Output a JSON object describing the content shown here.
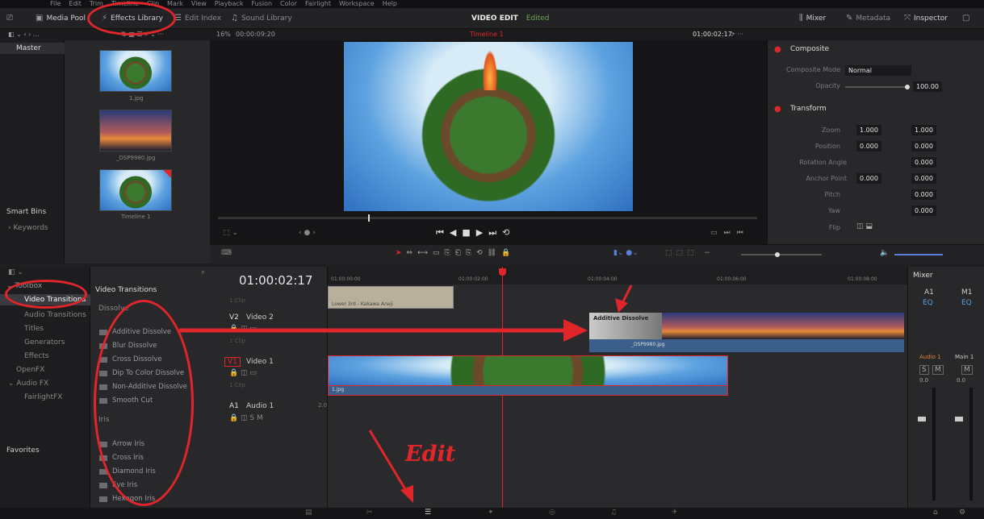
{
  "menubar": [
    "File",
    "Edit",
    "Trim",
    "Timeline",
    "Clip",
    "Mark",
    "View",
    "Playback",
    "Fusion",
    "Color",
    "Fairlight",
    "Workspace",
    "Help"
  ],
  "toolbar": {
    "media_pool": "Media Pool",
    "effects_library": "Effects Library",
    "edit_index": "Edit Index",
    "sound_library": "Sound Library",
    "project_title": "VIDEO EDIT",
    "project_status": "Edited",
    "mixer": "Mixer",
    "metadata": "Metadata",
    "inspector": "Inspector"
  },
  "viewer": {
    "zoom": "16%",
    "source_tc": "00:00:09:20",
    "timeline_name": "Timeline 1",
    "record_tc": "01:00:02:17"
  },
  "media_pool": {
    "bin": "Master",
    "smart_bins": "Smart Bins",
    "keywords": "Keywords",
    "clips": [
      {
        "label": "1.jpg"
      },
      {
        "label": "_DSP9980.jpg"
      },
      {
        "label": "Timeline 1"
      }
    ]
  },
  "effects": {
    "tree": [
      "Toolbox",
      "Video Transitions",
      "Audio Transitions",
      "Titles",
      "Generators",
      "Effects",
      "OpenFX",
      "Audio FX",
      "FairlightFX"
    ],
    "favorites": "Favorites",
    "header": "Video Transitions",
    "group_dissolve": "Dissolve",
    "dissolve": [
      "Additive Dissolve",
      "Blur Dissolve",
      "Cross Dissolve",
      "Dip To Color Dissolve",
      "Non-Additive Dissolve",
      "Smooth Cut"
    ],
    "group_iris": "Iris",
    "iris": [
      "Arrow Iris",
      "Cross Iris",
      "Diamond Iris",
      "Eye Iris",
      "Hexagon Iris"
    ]
  },
  "timeline": {
    "timecode": "01:00:02:17",
    "ruler": [
      "01:00:00:00",
      "01:00:02:00",
      "01:00:04:00",
      "01:00:06:00",
      "01:00:08:00"
    ],
    "tracks": [
      {
        "id": "V2",
        "name": "Video 2",
        "clips": "1 Clip"
      },
      {
        "id": "V1",
        "name": "Video 1",
        "clips": "1 Clip"
      },
      {
        "id": "A1",
        "name": "Audio 1",
        "level": "2.0"
      }
    ],
    "top_clip_label": "1 Clip",
    "lower_third_clip": "Lower 3rd - Kakawa Aneji",
    "v2_clip": "_DSP9980.jpg",
    "transition_label": "Additive Dissolve",
    "v1_clip": "1.jpg"
  },
  "mixer": {
    "title": "Mixer",
    "ch1": "A1",
    "ch2": "M1",
    "eq": "EQ",
    "audio1": "Audio 1",
    "main1": "Main 1",
    "s": "S",
    "m": "M",
    "db": "0.0"
  },
  "inspector": {
    "composite": "Composite",
    "composite_mode_label": "Composite Mode",
    "composite_mode": "Normal",
    "opacity_label": "Opacity",
    "opacity": "100.00",
    "transform": "Transform",
    "zoom_label": "Zoom",
    "zoom_x": "1.000",
    "zoom_y": "1.000",
    "position_label": "Position",
    "pos_x": "0.000",
    "pos_y": "0.000",
    "rotation_label": "Rotation Angle",
    "rotation": "0.000",
    "anchor_label": "Anchor Point",
    "anchor_x": "0.000",
    "anchor_y": "0.000",
    "pitch_label": "Pitch",
    "pitch": "0.000",
    "yaw_label": "Yaw",
    "yaw": "0.000",
    "flip_label": "Flip"
  },
  "annotation": {
    "edit_label": "Edit"
  },
  "colors": {
    "accent_red": "#e0262b",
    "clip_blue": "#3b5f8a",
    "playhead": "#e0262b"
  }
}
